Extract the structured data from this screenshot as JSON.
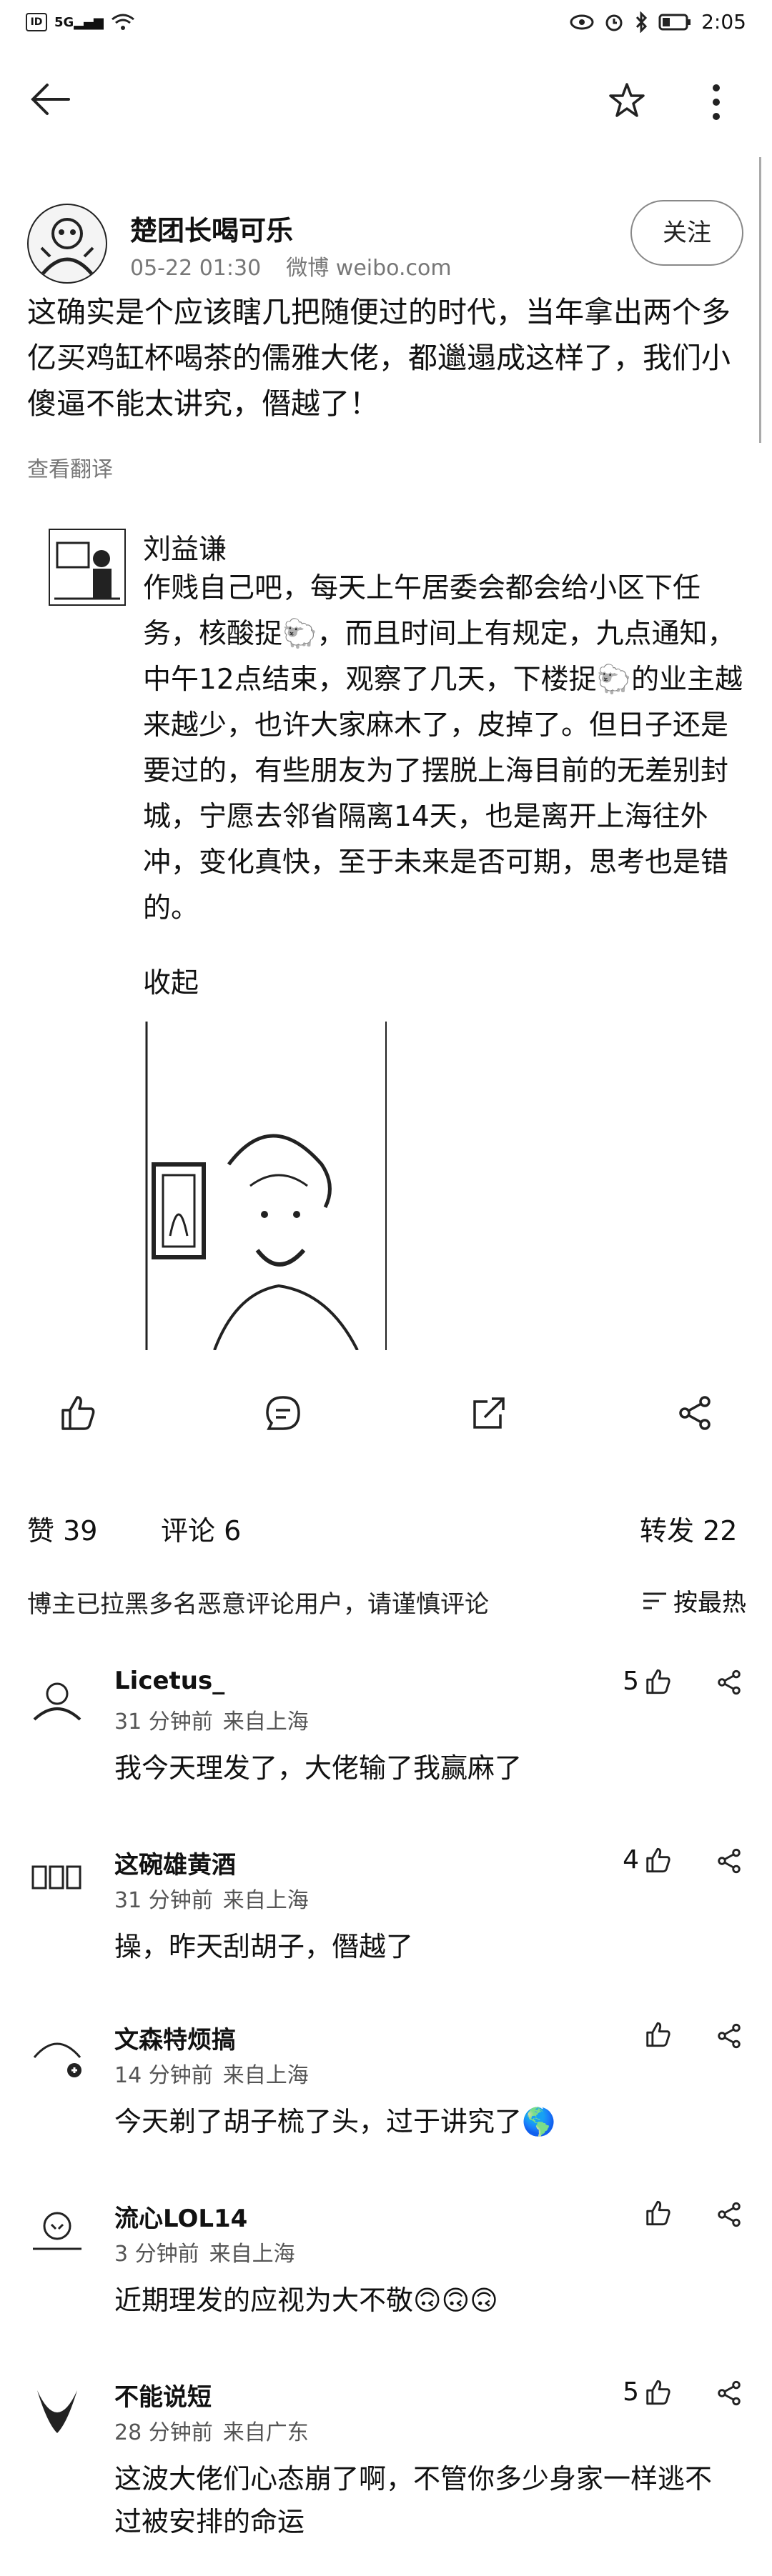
{
  "status_bar": {
    "left_icons": [
      "id-icon",
      "5g-signal-icon",
      "wifi-icon"
    ],
    "right_icons": [
      "eye-icon",
      "alarm-icon",
      "bluetooth-icon",
      "battery-icon"
    ],
    "time": "2:05"
  },
  "toolbar": {
    "back_icon": "back-arrow-icon",
    "star_icon": "star-icon",
    "more_icon": "more-vertical-icon"
  },
  "post": {
    "author": "楚团长喝可乐",
    "date": "05-22 01:30",
    "source": "微博 weibo.com",
    "follow_label": "关注",
    "text": "这确实是个应该瞎几把随便过的时代，当年拿出两个多亿买鸡缸杯喝茶的儒雅大佬，都邋遢成这样了，我们小傻逼不能太讲究，僭越了！",
    "translate_label": "查看翻译"
  },
  "quoted": {
    "author": "刘益谦",
    "text": "作贱自己吧，每天上午居委会都会给小区下任务，核酸捉🐑，而且时间上有规定，九点通知，中午12点结束，观察了几天，下楼捉🐑的业主越来越少，也许大家麻木了，皮掉了。但日子还是要过的，有些朋友为了摆脱上海目前的无差别封城，宁愿去邻省隔离14天，也是离开上海往外冲，变化真快，至于未来是否可期，思考也是错的。",
    "collapse_label": "收起"
  },
  "actions": {
    "like": "like-icon",
    "comment": "comment-icon",
    "share": "share-icon",
    "forward": "forward-icon"
  },
  "stats": {
    "likes": "赞 39",
    "comments": "评论 6",
    "reposts": "转发 22"
  },
  "comments_header": {
    "notice": "博主已拉黑多名恶意评论用户，请谨慎评论",
    "sort_label": "按最热"
  },
  "comments": [
    {
      "name": "Licetus_",
      "time": "31 分钟前",
      "location": "来自上海",
      "text": "我今天理发了，大佬输了我赢麻了",
      "likes": "5"
    },
    {
      "name": "这碗雄黄酒",
      "time": "31 分钟前",
      "location": "来自上海",
      "text": "操，昨天刮胡子，僭越了",
      "likes": "4"
    },
    {
      "name": "文森特烦搞",
      "time": "14 分钟前",
      "location": "来自上海",
      "text": "今天剃了胡子梳了头，过于讲究了🌎",
      "likes": ""
    },
    {
      "name": "流心LOL14",
      "time": "3 分钟前",
      "location": "来自上海",
      "text": "近期理发的应视为大不敬🙃🙃🙃",
      "likes": ""
    },
    {
      "name": "不能说短",
      "time": "28 分钟前",
      "location": "来自广东",
      "text": "这波大佬们心态崩了啊，不管你多少身家一样逃不过被安排的命运",
      "likes": "5"
    }
  ]
}
